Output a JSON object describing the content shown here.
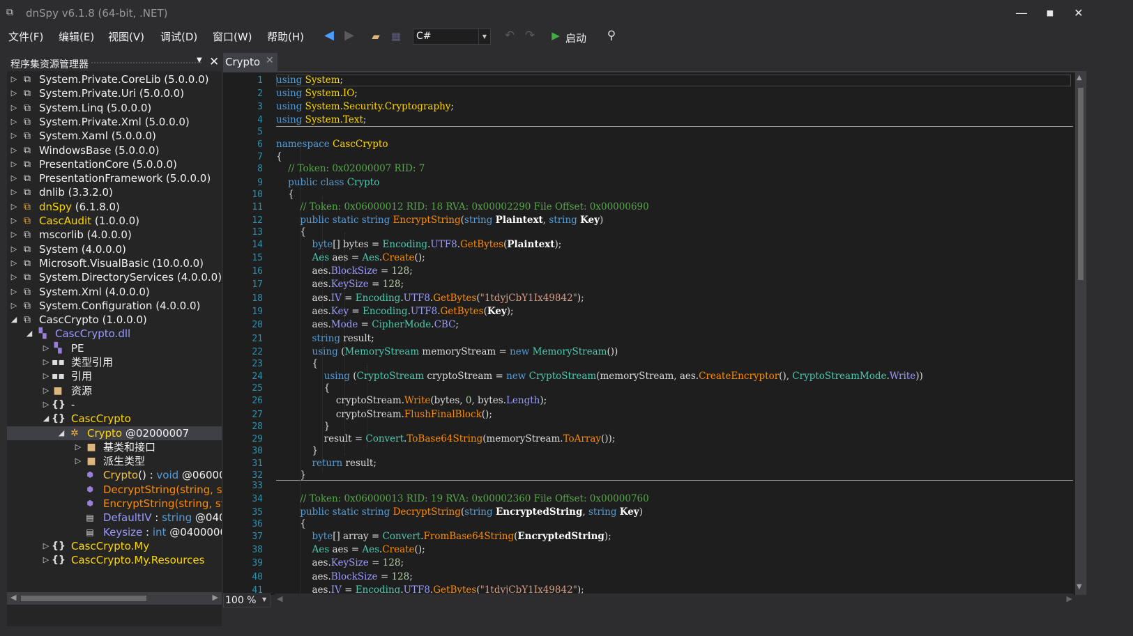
{
  "window": {
    "title": "dnSpy v6.1.8 (64-bit, .NET)",
    "minimize": "―",
    "maximize": "■",
    "close": "✕"
  },
  "menu": [
    "文件(F)",
    "编辑(E)",
    "视图(V)",
    "调试(D)",
    "窗口(W)",
    "帮助(H)"
  ],
  "toolbar": {
    "language": "C#",
    "run_label": "启动"
  },
  "assembly_panel": {
    "title": "程序集资源管理器",
    "items": [
      {
        "label": "System.Private.CoreLib",
        "version": " (5.0.0.0)"
      },
      {
        "label": "System.Private.Uri",
        "version": " (5.0.0.0)"
      },
      {
        "label": "System.Linq",
        "version": " (5.0.0.0)"
      },
      {
        "label": "System.Private.Xml",
        "version": " (5.0.0.0)"
      },
      {
        "label": "System.Xaml",
        "version": " (5.0.0.0)"
      },
      {
        "label": "WindowsBase",
        "version": " (5.0.0.0)"
      },
      {
        "label": "PresentationCore",
        "version": " (5.0.0.0)"
      },
      {
        "label": "PresentationFramework",
        "version": " (5.0.0.0)"
      },
      {
        "label": "dnlib",
        "version": " (3.3.2.0)"
      },
      {
        "label": "dnSpy",
        "version": " (6.1.8.0)"
      },
      {
        "label": "CascAudit",
        "version": " (1.0.0.0)"
      },
      {
        "label": "mscorlib",
        "version": " (4.0.0.0)"
      },
      {
        "label": "System",
        "version": " (4.0.0.0)"
      },
      {
        "label": "Microsoft.VisualBasic",
        "version": " (10.0.0.0)"
      },
      {
        "label": "System.DirectoryServices",
        "version": " (4.0.0.0)"
      },
      {
        "label": "System.Xml",
        "version": " (4.0.0.0)"
      },
      {
        "label": "System.Configuration",
        "version": " (4.0.0.0)"
      },
      {
        "label": "CascCrypto",
        "version": " (1.0.0.0)"
      }
    ],
    "module": "CascCrypto.dll",
    "module_children": [
      "PE",
      "类型引用",
      "引用",
      "资源",
      "-"
    ],
    "namespace": "CascCrypto",
    "class_label": "Crypto",
    "class_token": " @02000007",
    "class_children": [
      "基类和接口",
      "派生类型"
    ],
    "members": [
      {
        "name": "Crypto",
        "sig": "() : ",
        "type": "void",
        "tail": " @06000"
      },
      {
        "name": "DecryptString",
        "sig": "(string, st",
        "type": "",
        "tail": ""
      },
      {
        "name": "EncryptString",
        "sig": "(string, st",
        "type": "",
        "tail": ""
      },
      {
        "name": "DefaultIV",
        "sig": " : ",
        "type": "string",
        "tail": " @040"
      },
      {
        "name": "Keysize",
        "sig": " : ",
        "type": "int",
        "tail": " @0400000"
      }
    ],
    "more_namespaces": [
      "CascCrypto.My",
      "CascCrypto.My.Resources"
    ]
  },
  "editor": {
    "tab_label": "Crypto",
    "zoom": "100 %",
    "code": {
      "l1": "System",
      "l2": "System.IO",
      "l3": "System.Security.Cryptography",
      "l4": "System.Text",
      "ns": "CascCrypto",
      "c_class": "// Token: 0x02000007 RID: 7",
      "cls": "Crypto",
      "c_enc": "// Token: 0x06000012 RID: 18 RVA: 0x00002290 File Offset: 0x00000690",
      "enc": "EncryptString",
      "iv": "\"1tdyjCbY1Ix49842\"",
      "c_dec": "// Token: 0x06000013 RID: 19 RVA: 0x00002360 File Offset: 0x00000760",
      "dec": "DecryptString",
      "n128": "128",
      "n0": "0"
    }
  }
}
